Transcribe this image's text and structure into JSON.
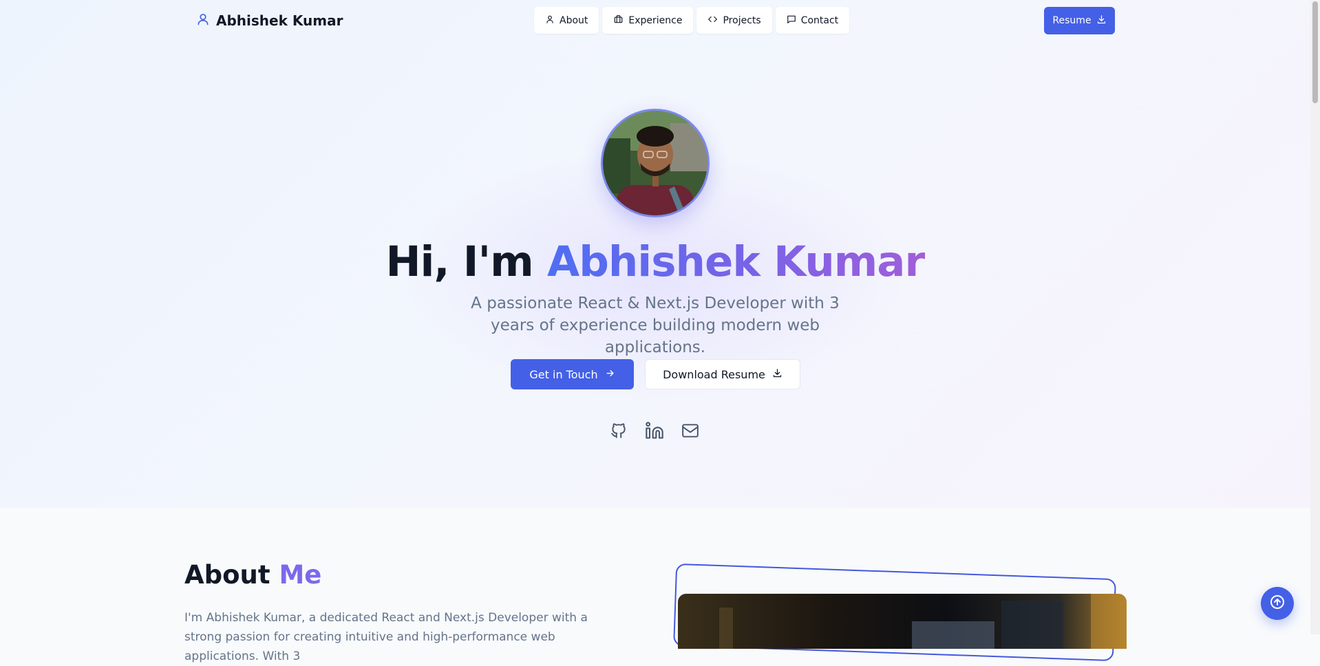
{
  "header": {
    "brand": "Abhishek Kumar",
    "nav": [
      {
        "label": "About",
        "icon": "user-icon"
      },
      {
        "label": "Experience",
        "icon": "briefcase-icon"
      },
      {
        "label": "Projects",
        "icon": "code-icon"
      },
      {
        "label": "Contact",
        "icon": "message-icon"
      }
    ],
    "resume_label": "Resume"
  },
  "hero": {
    "greeting": "Hi, I'm",
    "name": "Abhishek Kumar",
    "subtitle": "A passionate React & Next.js Developer with 3 years of experience building modern web applications.",
    "primary_cta": "Get in Touch",
    "secondary_cta": "Download Resume",
    "socials": [
      "github-icon",
      "linkedin-icon",
      "mail-icon"
    ]
  },
  "about": {
    "title_main": "About",
    "title_accent": "Me",
    "text": "I'm Abhishek Kumar, a dedicated React and Next.js Developer with a strong passion for creating intuitive and high-performance web applications. With 3"
  },
  "colors": {
    "primary": "#4460e6",
    "accent_purple": "#7b69ea",
    "text_dark": "#111827",
    "text_muted": "#64748b"
  }
}
